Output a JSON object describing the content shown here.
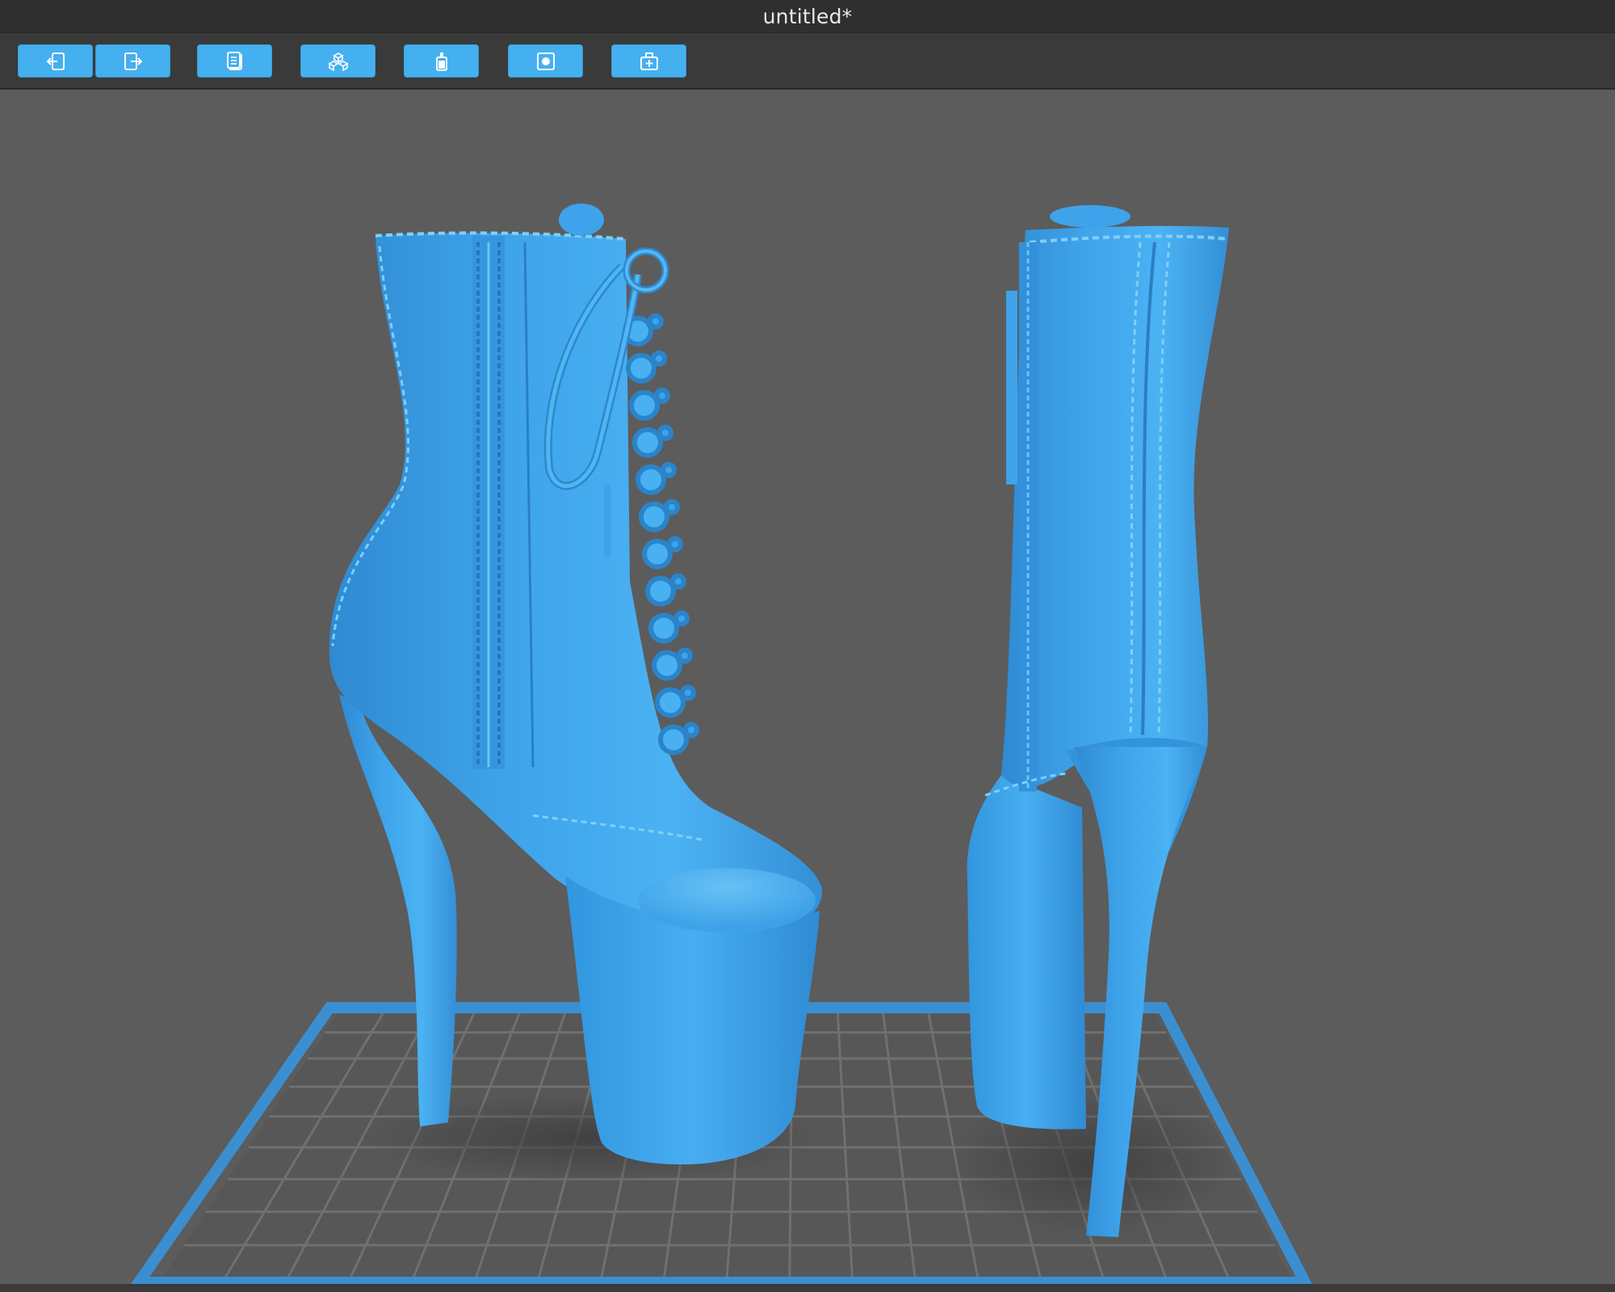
{
  "window": {
    "title": "untitled*"
  },
  "toolbar": {
    "buttons": [
      {
        "name": "import-button",
        "icon": "import-icon"
      },
      {
        "name": "export-button",
        "icon": "export-icon"
      },
      {
        "name": "document-button",
        "icon": "document-icon"
      },
      {
        "name": "components-button",
        "icon": "cubes-icon"
      },
      {
        "name": "support-button",
        "icon": "bottle-icon"
      },
      {
        "name": "view-button",
        "icon": "square-dot-icon"
      },
      {
        "name": "add-object-button",
        "icon": "box-plus-icon"
      }
    ]
  },
  "colors": {
    "accent": "#45b0ef",
    "model": "#3a9ee6",
    "model_highlight": "#55b4f2",
    "model_shadow": "#2d84c6",
    "viewport_bg": "#5c5c5c",
    "titlebar_bg": "#2f2f2f",
    "toolbar_bg": "#3a3a3a",
    "plate_border": "#3b8fd0",
    "grid_line": "#6e6e6e",
    "grid_fill": "#555555"
  }
}
